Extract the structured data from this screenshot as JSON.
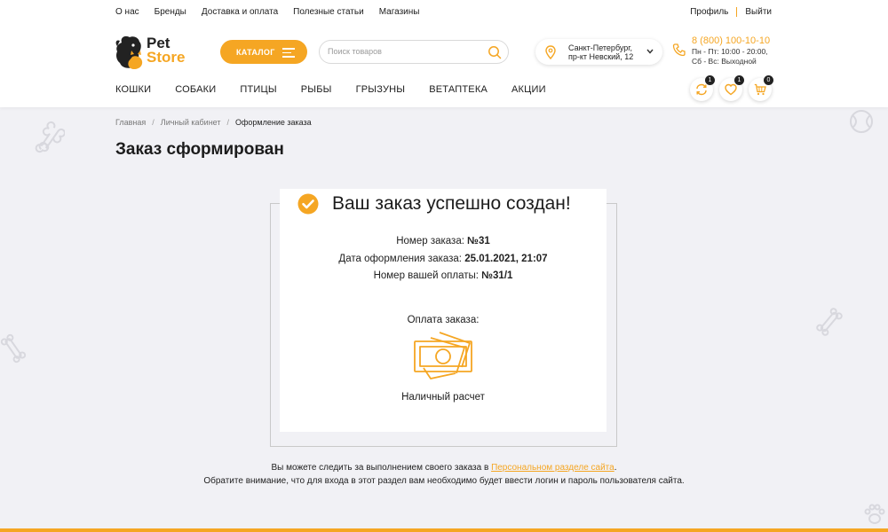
{
  "topnav": [
    {
      "label": "О нас"
    },
    {
      "label": "Бренды"
    },
    {
      "label": "Доставка и оплата"
    },
    {
      "label": "Полезные статьи"
    },
    {
      "label": "Магазины"
    }
  ],
  "user": {
    "profile": "Профиль",
    "logout": "Выйти"
  },
  "logo": {
    "line1": "Pet",
    "line2": "Store"
  },
  "catalog": {
    "label": "КАТАЛОГ"
  },
  "search": {
    "placeholder": "Поиск товаров",
    "value": ""
  },
  "location": {
    "line1": "Санкт-Петербург,",
    "line2": "пр-кт Невский, 12"
  },
  "contacts": {
    "phone": "8 (800) 100-10-10",
    "hours1": "Пн - Пт: 10:00 - 20:00,",
    "hours2": "Сб - Вс: Выходной"
  },
  "mainnav": [
    {
      "label": "КОШКИ"
    },
    {
      "label": "СОБАКИ"
    },
    {
      "label": "ПТИЦЫ"
    },
    {
      "label": "РЫБЫ"
    },
    {
      "label": "ГРЫЗУНЫ"
    },
    {
      "label": "ВЕТАПТЕКА"
    },
    {
      "label": "АКЦИИ"
    }
  ],
  "badges": {
    "compare": "1",
    "favorites": "1",
    "cart": "0"
  },
  "breadcrumb": {
    "home": "Главная",
    "cabinet": "Личный кабинет",
    "current": "Оформление заказа"
  },
  "page": {
    "title": "Заказ сформирован"
  },
  "order": {
    "success_title": "Ваш заказ успешно создан!",
    "number_label": "Номер заказа:",
    "number_value": "№31",
    "date_label": "Дата оформления заказа:",
    "date_value": "25.01.2021, 21:07",
    "payment_no_label": "Номер вашей оплаты:",
    "payment_no_value": "№31/1",
    "payment_label": "Оплата заказа:",
    "payment_method": "Наличный расчет"
  },
  "info": {
    "line1_prefix": "Вы можете следить за выполнением своего заказа в",
    "link": "Персональном разделе сайта",
    "line1_suffix": ".",
    "line2": "Обратите внимание, что для входа в этот раздел вам необходимо будет ввести логин и пароль пользователя сайта."
  },
  "colors": {
    "accent": "#f5a623",
    "background": "#f1f1f5",
    "text": "#1c1c1c"
  },
  "icons": [
    "dog-cat-logo-icon",
    "menu-icon",
    "search-icon",
    "location-pin-icon",
    "chevron-down-icon",
    "phone-icon",
    "compare-icon",
    "heart-icon",
    "cart-icon",
    "check-circle-icon",
    "cash-icon",
    "bone-icon",
    "ball-icon",
    "paw-icon"
  ]
}
